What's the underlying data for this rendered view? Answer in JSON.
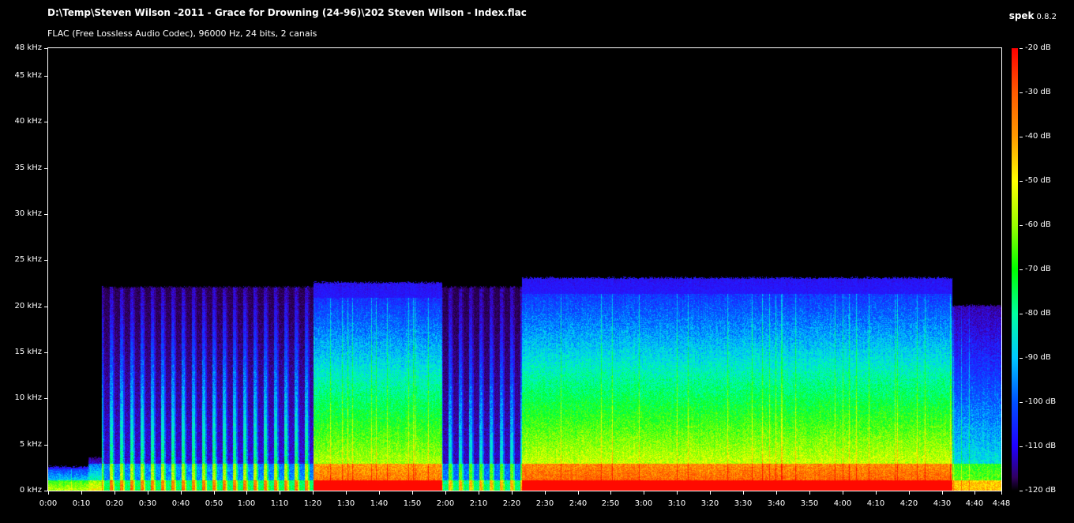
{
  "window": {
    "file_path": "D:\\Temp\\Steven Wilson -2011 - Grace for Drowning (24-96)\\202 Steven Wilson - Index.flac",
    "file_info": "FLAC (Free Lossless Audio Codec), 96000 Hz, 24 bits, 2 canais",
    "app_name": "spek",
    "app_version": "0.8.2"
  },
  "chart_data": {
    "type": "heatmap",
    "title": "D:\\Temp\\Steven Wilson -2011 - Grace for Drowning (24-96)\\202 Steven Wilson - Index.flac",
    "subtitle": "FLAC (Free Lossless Audio Codec), 96000 Hz, 24 bits, 2 canais",
    "x_ticks": [
      "0:00",
      "0:10",
      "0:20",
      "0:30",
      "0:40",
      "0:50",
      "1:00",
      "1:10",
      "1:20",
      "1:30",
      "1:40",
      "1:50",
      "2:00",
      "2:10",
      "2:20",
      "2:30",
      "2:40",
      "2:50",
      "3:00",
      "3:10",
      "3:20",
      "3:30",
      "3:40",
      "3:50",
      "4:00",
      "4:10",
      "4:20",
      "4:30",
      "4:40",
      "4:48"
    ],
    "x_range_seconds": [
      0,
      288
    ],
    "y_ticks": [
      "0 kHz",
      "5 kHz",
      "10 kHz",
      "15 kHz",
      "20 kHz",
      "25 kHz",
      "30 kHz",
      "35 kHz",
      "40 kHz",
      "45 kHz",
      "48 kHz"
    ],
    "y_range_khz": [
      0,
      48
    ],
    "colorbar_ticks": [
      "-20 dB",
      "-30 dB",
      "-40 dB",
      "-50 dB",
      "-60 dB",
      "-70 dB",
      "-80 dB",
      "-90 dB",
      "-100 dB",
      "-110 dB",
      "-120 dB"
    ],
    "colorbar_range_db": [
      -120,
      -20
    ],
    "spectral_cutoff_khz": 22.5,
    "segments": [
      {
        "start_s": 0,
        "end_s": 12,
        "cutoff_khz": 2.5,
        "level": 0.35
      },
      {
        "start_s": 12,
        "end_s": 16,
        "cutoff_khz": 3.5,
        "level": 0.4
      },
      {
        "start_s": 16,
        "end_s": 80,
        "cutoff_khz": 22,
        "level": 0.45,
        "pulsed": true
      },
      {
        "start_s": 80,
        "end_s": 119,
        "cutoff_khz": 22.5,
        "level": 0.7
      },
      {
        "start_s": 119,
        "end_s": 143,
        "cutoff_khz": 22,
        "level": 0.4,
        "pulsed": true
      },
      {
        "start_s": 143,
        "end_s": 273,
        "cutoff_khz": 23,
        "level": 0.72
      },
      {
        "start_s": 273,
        "end_s": 288,
        "cutoff_khz": 20,
        "level": 0.45
      }
    ],
    "colors": {
      "background": "#000000",
      "text": "#ffffff",
      "frame": "#ffffff"
    }
  }
}
